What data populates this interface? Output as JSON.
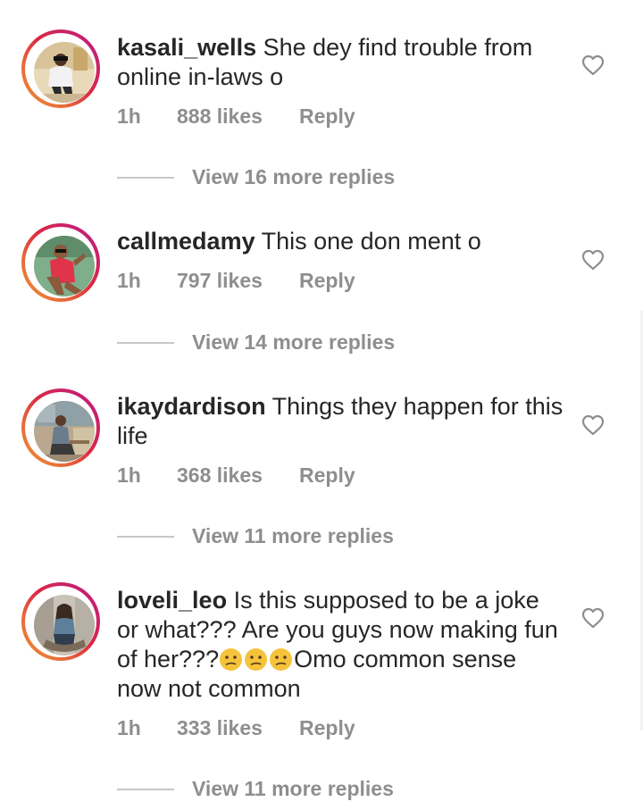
{
  "comments": [
    {
      "username": "kasali_wells",
      "text": " She dey find trouble from online in-laws o",
      "time": "1h",
      "likes": "888 likes",
      "reply_label": "Reply",
      "view_replies": "View 16 more replies"
    },
    {
      "username": "callmedamy",
      "text": " This one don ment o",
      "time": "1h",
      "likes": "797 likes",
      "reply_label": "Reply",
      "view_replies": "View 14 more replies"
    },
    {
      "username": "ikaydardison",
      "text": " Things they happen for this life",
      "time": "1h",
      "likes": "368 likes",
      "reply_label": "Reply",
      "view_replies": "View 11 more replies"
    },
    {
      "username": "loveli_leo",
      "text_before": " Is this supposed to be a joke or what??? Are you guys now making fun of her???",
      "emoji_name": "confused-face-emoji",
      "text_after": "Omo common sense now not common",
      "time": "1h",
      "likes": "333 likes",
      "reply_label": "Reply",
      "view_replies": "View 11 more replies"
    }
  ],
  "colors": {
    "text": "#262626",
    "secondary": "#8e8e8e",
    "divider": "#c7c7c7",
    "story_ring_start": "#f09433",
    "story_ring_end": "#bc1888"
  },
  "icons": {
    "like": "heart-outline-icon"
  }
}
